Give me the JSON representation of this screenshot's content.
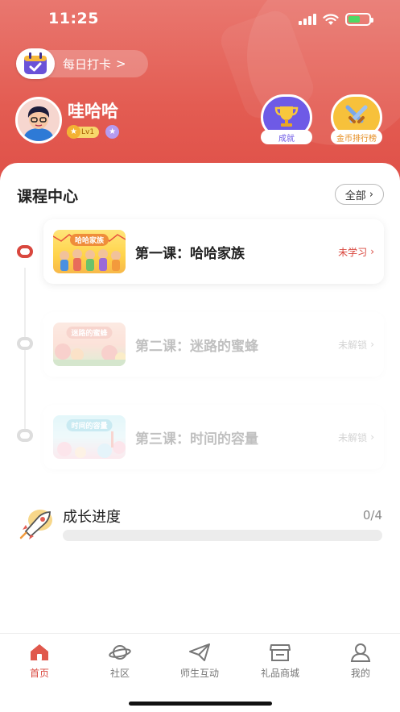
{
  "status_bar": {
    "time": "11:25"
  },
  "checkin": {
    "label": "每日打卡",
    "chevron": ">"
  },
  "user": {
    "name": "哇哈哈",
    "level": "Lv1"
  },
  "header_buttons": {
    "achievement": "成就",
    "leaderboard": "金币排行榜"
  },
  "course_center": {
    "title": "课程中心",
    "all_label": "全部",
    "lessons": [
      {
        "title": "第一课：哈哈家族",
        "thumb_title": "哈哈家族",
        "status": "未学习",
        "locked": false
      },
      {
        "title": "第二课：迷路的蜜蜂",
        "thumb_title": "迷路的蜜蜂",
        "status": "未解锁",
        "locked": true
      },
      {
        "title": "第三课：时间的容量",
        "thumb_title": "时间的容量",
        "status": "未解锁",
        "locked": true
      }
    ]
  },
  "growth": {
    "title": "成长进度",
    "completed": 0,
    "total": 4,
    "count_text": "0/4"
  },
  "tabs": [
    {
      "label": "首页",
      "icon": "home-icon",
      "active": true
    },
    {
      "label": "社区",
      "icon": "planet-icon",
      "active": false
    },
    {
      "label": "师生互动",
      "icon": "paper-plane-icon",
      "active": false
    },
    {
      "label": "礼品商城",
      "icon": "store-icon",
      "active": false
    },
    {
      "label": "我的",
      "icon": "user-icon",
      "active": false
    }
  ],
  "colors": {
    "accent": "#d9473e",
    "header_top": "#e9776f",
    "header_bottom": "#df4f47",
    "achievement": "#6e5ae6",
    "leaderboard": "#f7c13b"
  }
}
